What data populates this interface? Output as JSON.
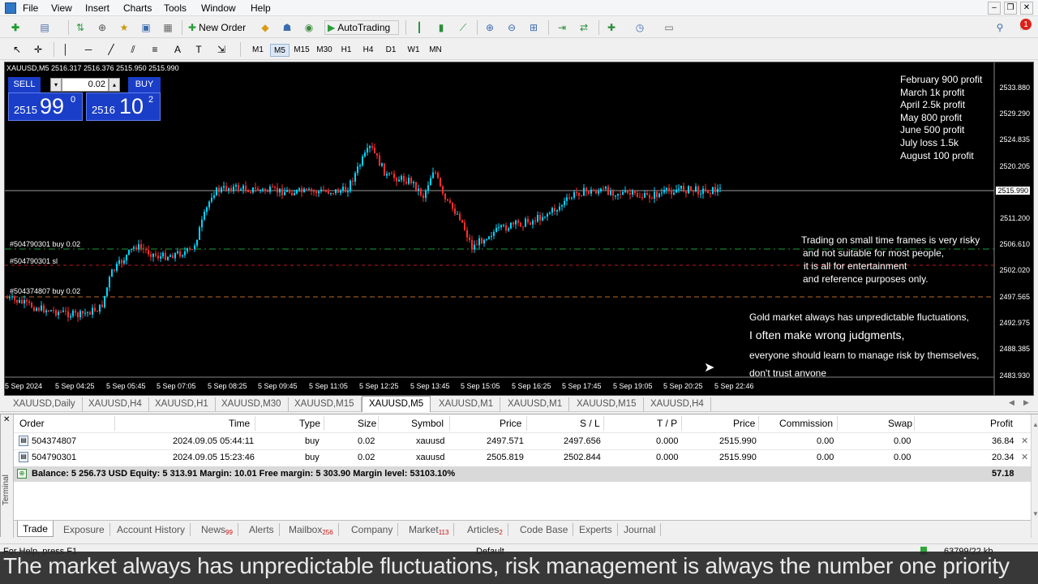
{
  "menu": {
    "items": [
      "File",
      "View",
      "Insert",
      "Charts",
      "Tools",
      "Window",
      "Help"
    ]
  },
  "toolbar": {
    "new_order": "New Order",
    "autotrading": "AutoTrading",
    "notification_count": "1",
    "timeframes": [
      "M1",
      "M5",
      "M15",
      "M30",
      "H1",
      "H4",
      "D1",
      "W1",
      "MN"
    ],
    "active_timeframe": "M5"
  },
  "chart": {
    "header": "XAUUSD,M5  2516.317 2516.376 2515.950 2515.990",
    "trade_panel": {
      "sell_label": "SELL",
      "buy_label": "BUY",
      "volume": "0.02",
      "sell_price_small": "2515",
      "sell_price_big": "99",
      "sell_price_sup": "0",
      "buy_price_small": "2516",
      "buy_price_big": "10",
      "buy_price_sup": "2"
    },
    "profit_notes": [
      "February 900 profit",
      "March 1k profit",
      "April 2.5k profit",
      "May 800 profit",
      "June 500 profit",
      "July loss 1.5k",
      "August 100 profit"
    ],
    "disclaimer": [
      "Trading on small time frames is very risky",
      "and not suitable for most people,",
      "it is all for entertainment",
      "and reference purposes only."
    ],
    "gold_note": [
      "Gold market always has unpredictable fluctuations,",
      "I often make wrong judgments,",
      "everyone should learn to manage risk by themselves,",
      "don't trust anyone"
    ],
    "order_labels": [
      "#504790301 buy 0.02",
      "#504790301 sl",
      "#504374807 buy 0.02"
    ],
    "price_labels": [
      "2533.880",
      "2529.290",
      "2524.835",
      "2520.205",
      "2515.990",
      "2511.200",
      "2506.610",
      "2502.020",
      "2497.565",
      "2492.975",
      "2488.385",
      "2483.930"
    ],
    "current_price": "2515.990",
    "time_labels": [
      "5 Sep 2024",
      "5 Sep 04:25",
      "5 Sep 05:45",
      "5 Sep 07:05",
      "5 Sep 08:25",
      "5 Sep 09:45",
      "5 Sep 11:05",
      "5 Sep 12:25",
      "5 Sep 13:45",
      "5 Sep 15:05",
      "5 Sep 16:25",
      "5 Sep 17:45",
      "5 Sep 19:05",
      "5 Sep 20:25",
      "5 Sep 22:46"
    ],
    "colors": {
      "bull": "#00d4ff",
      "bear": "#ff2d2d",
      "buy_line": "#1d9a3a",
      "sl_line": "#c01818"
    }
  },
  "chart_tabs": [
    "XAUUSD,Daily",
    "XAUUSD,H4",
    "XAUUSD,H1",
    "XAUUSD,M30",
    "XAUUSD,M15",
    "XAUUSD,M5",
    "XAUUSD,M1",
    "XAUUSD,M1",
    "XAUUSD,M15",
    "XAUUSD,H4"
  ],
  "active_chart_tab": "XAUUSD,M5",
  "terminal": {
    "side_label": "Terminal",
    "columns": [
      "Order",
      "Time",
      "Type",
      "Size",
      "Symbol",
      "Price",
      "S / L",
      "T / P",
      "Price",
      "Commission",
      "Swap",
      "Profit"
    ],
    "rows": [
      [
        "504374807",
        "2024.09.05 05:44:11",
        "buy",
        "0.02",
        "xauusd",
        "2497.571",
        "2497.656",
        "0.000",
        "2515.990",
        "0.00",
        "0.00",
        "36.84"
      ],
      [
        "504790301",
        "2024.09.05 15:23:46",
        "buy",
        "0.02",
        "xauusd",
        "2505.819",
        "2502.844",
        "0.000",
        "2515.990",
        "0.00",
        "0.00",
        "20.34"
      ]
    ],
    "balance_line": "Balance: 5 256.73 USD  Equity: 5 313.91  Margin: 10.01  Free margin: 5 303.90  Margin level: 53103.10%",
    "total_profit": "57.18",
    "tabs": [
      {
        "label": "Trade",
        "badge": ""
      },
      {
        "label": "Exposure",
        "badge": ""
      },
      {
        "label": "Account History",
        "badge": ""
      },
      {
        "label": "News",
        "badge": "99"
      },
      {
        "label": "Alerts",
        "badge": ""
      },
      {
        "label": "Mailbox",
        "badge": "256"
      },
      {
        "label": "Company",
        "badge": ""
      },
      {
        "label": "Market",
        "badge": "113"
      },
      {
        "label": "Articles",
        "badge": "2"
      },
      {
        "label": "Code Base",
        "badge": ""
      },
      {
        "label": "Experts",
        "badge": ""
      },
      {
        "label": "Journal",
        "badge": ""
      }
    ]
  },
  "statusbar": {
    "help": "For Help, press F1",
    "profile": "Default",
    "traffic": "63799/22 kb"
  },
  "caption": "The market always has unpredictable fluctuations, risk management is always the number one priority"
}
